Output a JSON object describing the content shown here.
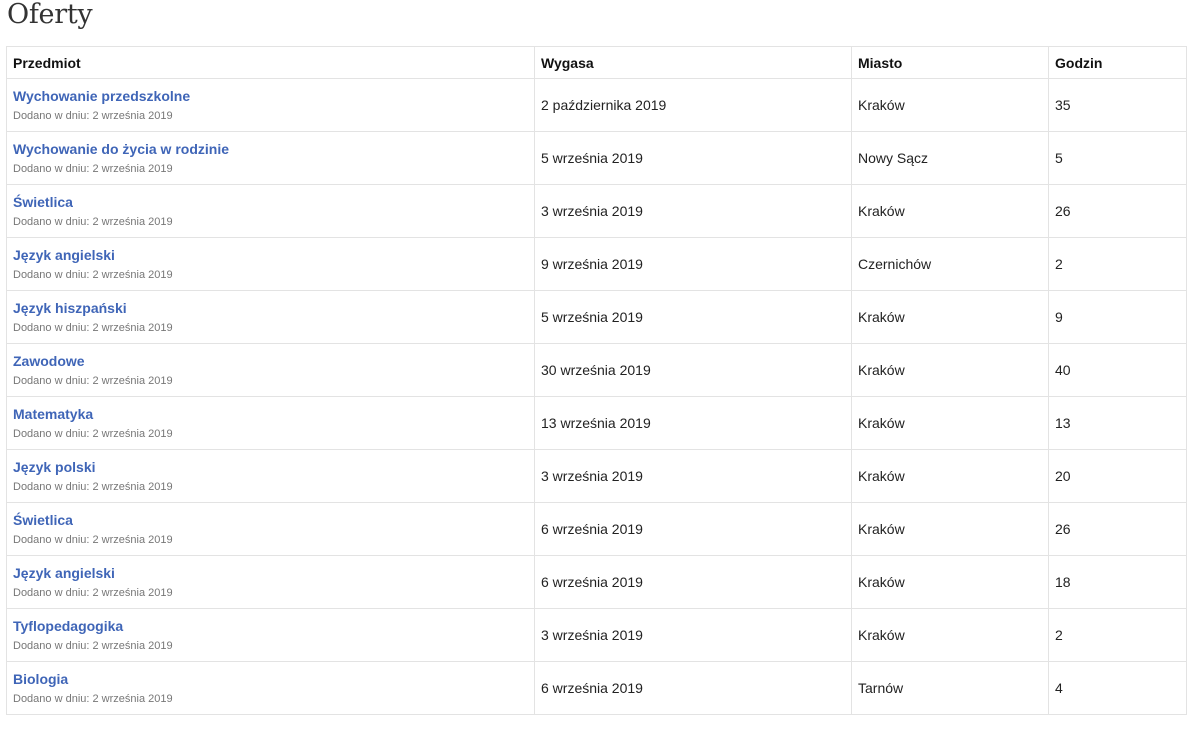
{
  "page": {
    "title": "Oferty"
  },
  "table": {
    "headers": {
      "subject": "Przedmiot",
      "expires": "Wygasa",
      "city": "Miasto",
      "hours": "Godzin"
    },
    "rows": [
      {
        "subject": "Wychowanie przedszkolne",
        "added": "Dodano w dniu: 2 września 2019",
        "expires": "2 października 2019",
        "city": "Kraków",
        "hours": "35"
      },
      {
        "subject": "Wychowanie do życia w rodzinie",
        "added": "Dodano w dniu: 2 września 2019",
        "expires": "5 września 2019",
        "city": "Nowy Sącz",
        "hours": "5"
      },
      {
        "subject": "Świetlica",
        "added": "Dodano w dniu: 2 września 2019",
        "expires": "3 września 2019",
        "city": "Kraków",
        "hours": "26"
      },
      {
        "subject": "Język angielski",
        "added": "Dodano w dniu: 2 września 2019",
        "expires": "9 września 2019",
        "city": "Czernichów",
        "hours": "2"
      },
      {
        "subject": "Język hiszpański",
        "added": "Dodano w dniu: 2 września 2019",
        "expires": "5 września 2019",
        "city": "Kraków",
        "hours": "9"
      },
      {
        "subject": "Zawodowe",
        "added": "Dodano w dniu: 2 września 2019",
        "expires": "30 września 2019",
        "city": "Kraków",
        "hours": "40"
      },
      {
        "subject": "Matematyka",
        "added": "Dodano w dniu: 2 września 2019",
        "expires": "13 września 2019",
        "city": "Kraków",
        "hours": "13"
      },
      {
        "subject": "Język polski",
        "added": "Dodano w dniu: 2 września 2019",
        "expires": "3 września 2019",
        "city": "Kraków",
        "hours": "20"
      },
      {
        "subject": "Świetlica",
        "added": "Dodano w dniu: 2 września 2019",
        "expires": "6 września 2019",
        "city": "Kraków",
        "hours": "26"
      },
      {
        "subject": "Język angielski",
        "added": "Dodano w dniu: 2 września 2019",
        "expires": "6 września 2019",
        "city": "Kraków",
        "hours": "18"
      },
      {
        "subject": "Tyflopedagogika",
        "added": "Dodano w dniu: 2 września 2019",
        "expires": "3 września 2019",
        "city": "Kraków",
        "hours": "2"
      },
      {
        "subject": "Biologia",
        "added": "Dodano w dniu: 2 września 2019",
        "expires": "6 września 2019",
        "city": "Tarnów",
        "hours": "4"
      }
    ]
  },
  "colors": {
    "link": "#3f65b7",
    "muted": "#777777",
    "border": "#e3e3e3"
  }
}
